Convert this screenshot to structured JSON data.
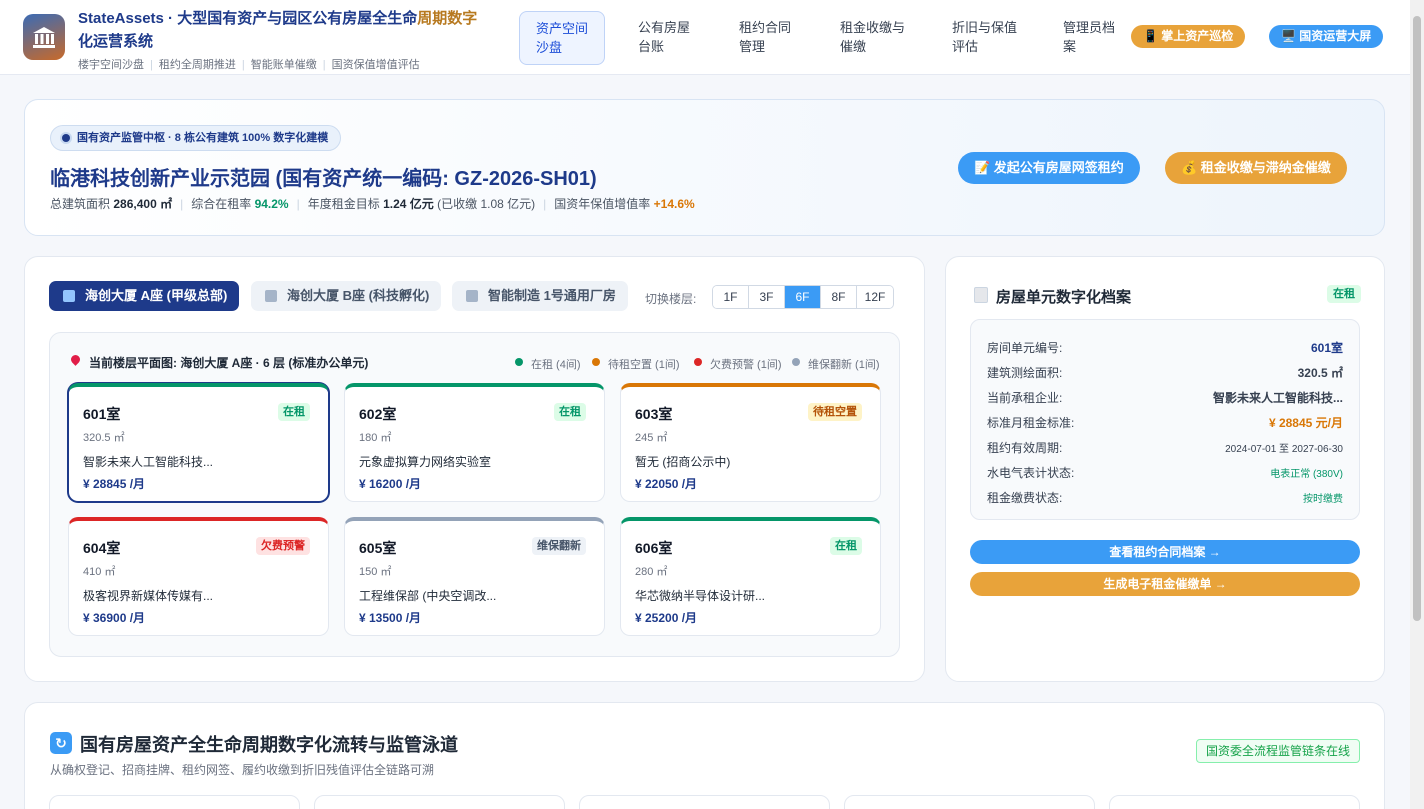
{
  "header": {
    "brand_title_a": "StateAssets · 大型国有资产与园区公有房屋全生命",
    "brand_title_b": "周期数字",
    "brand_title_c": "化运营系统",
    "brand_sub": [
      "楼宇空间沙盘",
      "租约全周期推进",
      "智能账单催缴",
      "国资保值增值评估"
    ],
    "nav": [
      {
        "line1": "资产空间",
        "line2": "沙盘",
        "active": true
      },
      {
        "line1": "公有房屋",
        "line2": "台账",
        "active": false
      },
      {
        "line1": "租约合同",
        "line2": "管理",
        "active": false
      },
      {
        "line1": "租金收缴与",
        "line2": "催缴",
        "active": false
      },
      {
        "line1": "折旧与保值",
        "line2": "评估",
        "active": false
      },
      {
        "line1": "管理员档",
        "line2": "案",
        "active": false
      }
    ],
    "btn_patrol": "📱 掌上资产巡检",
    "btn_screen": "🖥️ 国资运营大屏"
  },
  "hero": {
    "tag": "国有资产监管中枢 · 8 栋公有建筑 100% 数字化建模",
    "title": "临港科技创新产业示范园 (国有资产统一编码: GZ-2026-SH01)",
    "area_label": "总建筑面积",
    "area_value": "286,400 ㎡",
    "occupancy_label": "综合在租率",
    "occupancy_value": "94.2%",
    "rent_label": "年度租金目标",
    "rent_value": "1.24 亿元",
    "rent_collected": "(已收缴 1.08 亿元)",
    "growth_label": "国资年保值增值率",
    "growth_value": "+14.6%",
    "btn_sign": "📝 发起公有房屋网签租约",
    "btn_collect": "💰 租金收缴与滞纳金催缴"
  },
  "buildings": [
    {
      "label": "海创大厦 A座 (甲级总部)",
      "active": true
    },
    {
      "label": "海创大厦 B座 (科技孵化)",
      "active": false
    },
    {
      "label": "智能制造 1号通用厂房",
      "active": false
    }
  ],
  "floor_switch_label": "切换楼层:",
  "floors": [
    "1F",
    "3F",
    "6F",
    "8F",
    "12F"
  ],
  "active_floor": "6F",
  "plan": {
    "title": "当前楼层平面图: 海创大厦 A座 · 6 层 (标准办公单元)",
    "legend": [
      {
        "label": "在租 (4间)",
        "color": "#059669"
      },
      {
        "label": "待租空置 (1间)",
        "color": "#d97706"
      },
      {
        "label": "欠费预警 (1间)",
        "color": "#dc2626"
      },
      {
        "label": "维保翻新 (1间)",
        "color": "#94a3b8"
      }
    ]
  },
  "rooms": [
    {
      "no": "601室",
      "area": "320.5 ㎡",
      "tenant": "智影未来人工智能科技...",
      "rent": "¥ 28845 /月",
      "status": "在租",
      "color": "#059669",
      "badge": "b-green"
    },
    {
      "no": "602室",
      "area": "180 ㎡",
      "tenant": "元象虚拟算力网络实验室",
      "rent": "¥ 16200 /月",
      "status": "在租",
      "color": "#059669",
      "badge": "b-green"
    },
    {
      "no": "603室",
      "area": "245 ㎡",
      "tenant": "暂无 (招商公示中)",
      "rent": "¥ 22050 /月",
      "status": "待租空置",
      "color": "#d97706",
      "badge": "b-orange"
    },
    {
      "no": "604室",
      "area": "410 ㎡",
      "tenant": "极客视界新媒体传媒有...",
      "rent": "¥ 36900 /月",
      "status": "欠费预警",
      "color": "#dc2626",
      "badge": "b-red"
    },
    {
      "no": "605室",
      "area": "150 ㎡",
      "tenant": "工程维保部 (中央空调改...",
      "rent": "¥ 13500 /月",
      "status": "维保翻新",
      "color": "#94a3b8",
      "badge": "b-gray"
    },
    {
      "no": "606室",
      "area": "280 ㎡",
      "tenant": "华芯微纳半导体设计研...",
      "rent": "¥ 25200 /月",
      "status": "在租",
      "color": "#059669",
      "badge": "b-green"
    }
  ],
  "side": {
    "title": "房屋单元数字化档案",
    "status": "在租",
    "rows": [
      {
        "label": "房间单元编号:",
        "value": "601室",
        "color": "#1e3a8a",
        "size": "12px",
        "bold": true
      },
      {
        "label": "建筑测绘面积:",
        "value": "320.5 ㎡",
        "color": "#1f2937",
        "size": "12px",
        "bold": true
      },
      {
        "label": "当前承租企业:",
        "value": "智影未来人工智能科技...",
        "color": "#1f2937",
        "size": "12px",
        "bold": true
      },
      {
        "label": "标准月租金标准:",
        "value": "¥ 28845 元/月",
        "color": "#d97706",
        "size": "12px",
        "bold": true
      },
      {
        "label": "租约有效周期:",
        "value": "2024-07-01 至 2027-06-30",
        "color": "#374151",
        "size": "10px",
        "bold": false
      },
      {
        "label": "水电气表计状态:",
        "value": "电表正常 (380V)",
        "color": "#059669",
        "size": "10px",
        "bold": false
      },
      {
        "label": "租金缴费状态:",
        "value": "按时缴费",
        "color": "#059669",
        "size": "10px",
        "bold": false
      }
    ],
    "btn_contract": "查看租约合同档案 →",
    "btn_bill": "生成电子租金催缴单 →"
  },
  "bottom": {
    "icon": "↻",
    "title": "国有房屋资产全生命周期数字化流转与监管泳道",
    "subtitle": "从确权登记、招商挂牌、租约网签、履约收缴到折旧残值评估全链路可溯",
    "badge": "国资委全流程监管链条在线"
  }
}
